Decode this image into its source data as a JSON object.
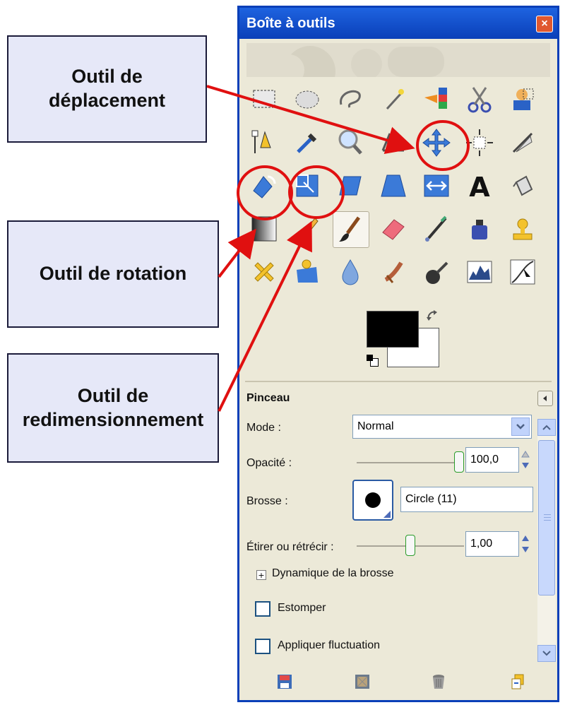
{
  "callouts": [
    {
      "text": "Outil de\ndéplacement"
    },
    {
      "text": "Outil de rotation"
    },
    {
      "text": "Outil de\nredimensionnement"
    }
  ],
  "window": {
    "title": "Boîte à outils",
    "close_glyph": "×"
  },
  "tools": [
    {
      "name": "rect-select-icon"
    },
    {
      "name": "ellipse-select-icon"
    },
    {
      "name": "lasso-icon"
    },
    {
      "name": "magic-wand-icon"
    },
    {
      "name": "select-by-color-icon"
    },
    {
      "name": "scissors-icon"
    },
    {
      "name": "foreground-select-icon"
    },
    {
      "name": "paths-icon"
    },
    {
      "name": "color-picker-icon"
    },
    {
      "name": "zoom-icon"
    },
    {
      "name": "measure-icon"
    },
    {
      "name": "move-icon"
    },
    {
      "name": "align-icon"
    },
    {
      "name": "crop-icon"
    },
    {
      "name": "rotate-icon"
    },
    {
      "name": "scale-icon"
    },
    {
      "name": "shear-icon"
    },
    {
      "name": "perspective-icon"
    },
    {
      "name": "flip-icon"
    },
    {
      "name": "text-icon"
    },
    {
      "name": "bucket-fill-icon"
    },
    {
      "name": "gradient-icon"
    },
    {
      "name": "pencil-icon"
    },
    {
      "name": "paintbrush-icon"
    },
    {
      "name": "eraser-icon"
    },
    {
      "name": "airbrush-icon"
    },
    {
      "name": "ink-icon"
    },
    {
      "name": "clone-icon"
    },
    {
      "name": "heal-icon"
    },
    {
      "name": "perspective-clone-icon"
    },
    {
      "name": "blur-icon"
    },
    {
      "name": "smudge-icon"
    },
    {
      "name": "dodge-burn-icon"
    },
    {
      "name": "levels-icon"
    },
    {
      "name": "curves-icon"
    }
  ],
  "colors": {
    "foreground": "#000000",
    "background": "#ffffff",
    "accent": "#0a3fb8",
    "highlight_circle": "#e01010",
    "arrow": "#e01010"
  },
  "options": {
    "title": "Pinceau",
    "mode_label": "Mode :",
    "mode_value": "Normal",
    "opacity_label": "Opacité :",
    "opacity_value": "100,0",
    "opacity_level": 1.0,
    "brush_label": "Brosse :",
    "brush_name": "Circle (11)",
    "scale_label": "Étirer ou rétrécir :",
    "scale_value": "1,00",
    "scale_level": 0.5,
    "dynamics_label": "Dynamique de la brosse",
    "dynamics_expander": "+",
    "fade_label": "Estomper",
    "jitter_label": "Appliquer fluctuation"
  },
  "bottom_icons": [
    "save-icon",
    "restore-icon",
    "delete-icon",
    "reset-icon"
  ]
}
